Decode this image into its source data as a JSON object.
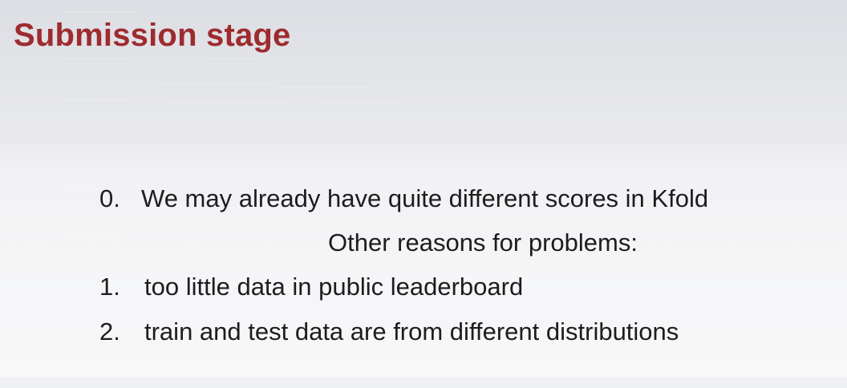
{
  "slide": {
    "title": "Submission stage",
    "first_item": {
      "number": "0.",
      "text": "We may already have quite different scores in Kfold"
    },
    "subheading": "Other reasons for problems:",
    "items": [
      {
        "number": "1.",
        "text": "too little data in public leaderboard"
      },
      {
        "number": "2.",
        "text": "train and test data are from different distributions"
      }
    ]
  },
  "colors": {
    "title": "#9e2b2f",
    "body_text": "#1d1d1f",
    "background": "#e9eaed"
  }
}
